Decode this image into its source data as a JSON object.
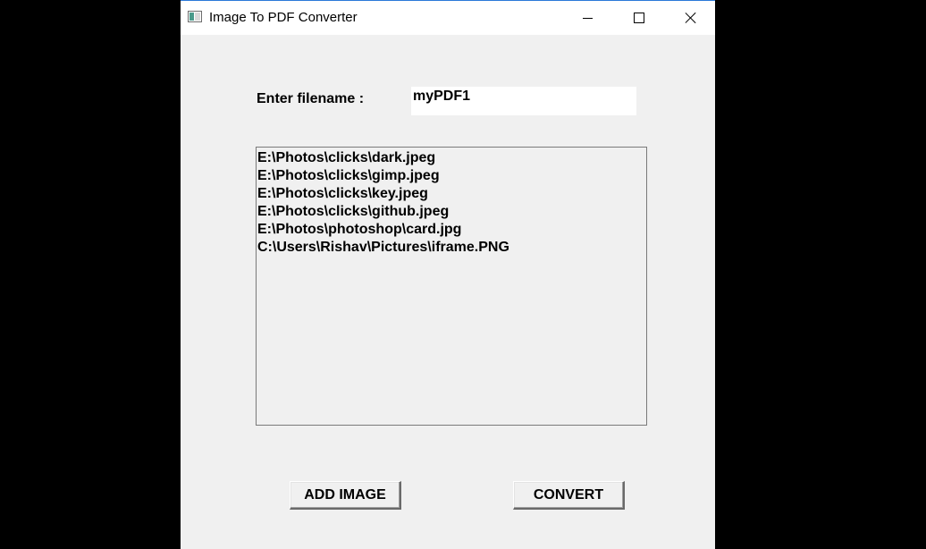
{
  "window": {
    "title": "Image To PDF Converter"
  },
  "icons": {
    "app": "app-icon",
    "minimize": "minimize-icon",
    "maximize": "maximize-icon",
    "close": "close-icon"
  },
  "form": {
    "filename_label": "Enter filename :",
    "filename_value": "myPDF1"
  },
  "image_list": [
    "E:\\Photos\\clicks\\dark.jpeg",
    "E:\\Photos\\clicks\\gimp.jpeg",
    "E:\\Photos\\clicks\\key.jpeg",
    "E:\\Photos\\clicks\\github.jpeg",
    "E:\\Photos\\photoshop\\card.jpg",
    "C:\\Users\\Rishav\\Pictures\\iframe.PNG"
  ],
  "buttons": {
    "add_image": "ADD IMAGE",
    "convert": "CONVERT"
  },
  "colors": {
    "desktop": "#000000",
    "window_bg": "#f0f0f0",
    "titlebar_bg": "#ffffff"
  }
}
